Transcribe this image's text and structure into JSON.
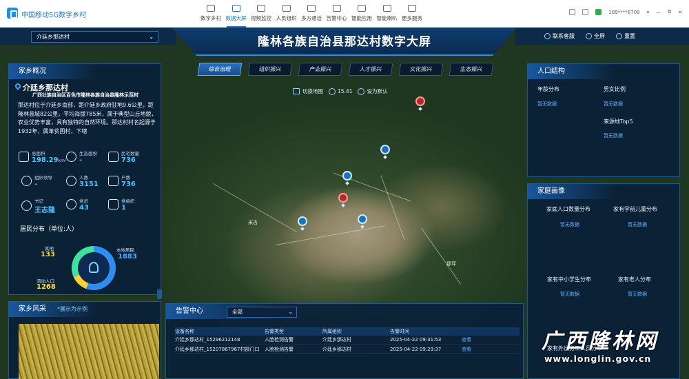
{
  "topbar": {
    "app_title": "中国移动5G数字乡村",
    "nav": [
      {
        "label": "数字乡村",
        "icon": "house-icon"
      },
      {
        "label": "数据大屏",
        "icon": "screen-icon",
        "active": true
      },
      {
        "label": "视频监控",
        "icon": "camera-icon"
      },
      {
        "label": "人员组织",
        "icon": "people-icon"
      },
      {
        "label": "多方通话",
        "icon": "phone-icon"
      },
      {
        "label": "告警中心",
        "icon": "bell-icon"
      },
      {
        "label": "智能应用",
        "icon": "apps-icon"
      },
      {
        "label": "智能喇叭",
        "icon": "speaker-icon"
      },
      {
        "label": "更多服务",
        "icon": "gift-icon"
      }
    ],
    "user": "189****6709"
  },
  "header": {
    "title": "隆林各族自治县那达村数字大屏",
    "village_select": "介廷乡那达村",
    "buttons": {
      "contact": "联系客服",
      "fullscreen": "全屏",
      "reset": "重置"
    }
  },
  "tabs": [
    "综合治理",
    "组织振兴",
    "产业振兴",
    "人才振兴",
    "文化振兴",
    "生态振兴"
  ],
  "map_tools": {
    "switch_map": "切换地图",
    "zoom": "15.41",
    "set_default": "设为默认"
  },
  "home": {
    "title": "家乡概况",
    "name": "介廷乡那达村",
    "address": "广西壮族自治区百色市隆林各族自治县隆林示范村",
    "description": "那达村位于介廷乡南部，距介廷乡政府驻地9.6公里，距隆林县城82公里，平均海拔785米，属于典型山丘地貌，农业优势丰富，具有独特的自然环境。那达村村名起源于1932年，属革贫困村，下辖",
    "stats": [
      {
        "label": "总面积",
        "value": "198.29",
        "unit": "km²",
        "icon": "area-icon"
      },
      {
        "label": "生态面积",
        "value": "-",
        "unit": "",
        "icon": "leaf-icon"
      },
      {
        "label": "民宅数量",
        "value": "736",
        "unit": "",
        "icon": "house-icon"
      },
      {
        "label": "组织领导",
        "value": "-",
        "unit": "",
        "icon": "leader-icon"
      },
      {
        "label": "人数",
        "value": "3151",
        "unit": "",
        "icon": "person-icon"
      },
      {
        "label": "户数",
        "value": "736",
        "unit": "",
        "icon": "family-icon"
      },
      {
        "label": "书记",
        "value": "王志隆",
        "unit": "",
        "icon": "secretary-icon"
      },
      {
        "label": "党员",
        "value": "43",
        "unit": "",
        "icon": "party-member-icon"
      },
      {
        "label": "党组织",
        "value": "1",
        "unit": "",
        "icon": "party-org-icon"
      }
    ],
    "distribution_title": "居民分布（单位:人）",
    "distribution": [
      {
        "label": "其他",
        "value": "133",
        "color": "#ffd233"
      },
      {
        "label": "本地居民",
        "value": "1883",
        "color": "#2f8df0"
      },
      {
        "label": "流动人口",
        "value": "1268",
        "color": "#40e0a0"
      }
    ]
  },
  "scene": {
    "title": "家乡风采",
    "note": "*展示为示例"
  },
  "population": {
    "title": "人口结构",
    "items": [
      {
        "label": "年龄分布",
        "value": "暂无数据"
      },
      {
        "label": "男女比例",
        "value": "暂无数据"
      },
      {
        "label": "来源地Top5",
        "value": "暂无数据"
      }
    ]
  },
  "family": {
    "title": "家庭画像",
    "items": [
      {
        "label": "家庭人口数量分布",
        "value": "暂无数据"
      },
      {
        "label": "家有学前儿童分布",
        "value": "暂无数据"
      },
      {
        "label": "家有中小学生分布",
        "value": "暂无数据"
      },
      {
        "label": "家有老人分布",
        "value": "暂无数据"
      },
      {
        "label": "家有外出务工人员分布",
        "value": ""
      }
    ]
  },
  "alarm": {
    "title": "告警中心",
    "filter": "全部",
    "columns": [
      "设备名称",
      "告警类型",
      "所属组织",
      "告警时间",
      ""
    ],
    "rows": [
      [
        "介廷乡那达村_15296212148",
        "人脸检测告警",
        "介廷乡那达村",
        "2025-04-22 09:31:53",
        "查看"
      ],
      [
        "介廷乡那达村_15207867967村部门口",
        "人脸检测告警",
        "介廷乡那达村",
        "2025-04-22 09:29:37",
        "查看"
      ]
    ]
  },
  "map_labels": {
    "label1": "米吉",
    "label2": "那坪"
  },
  "watermark": {
    "name": "广西隆林网",
    "url": "www.longlin.gov.cn"
  }
}
